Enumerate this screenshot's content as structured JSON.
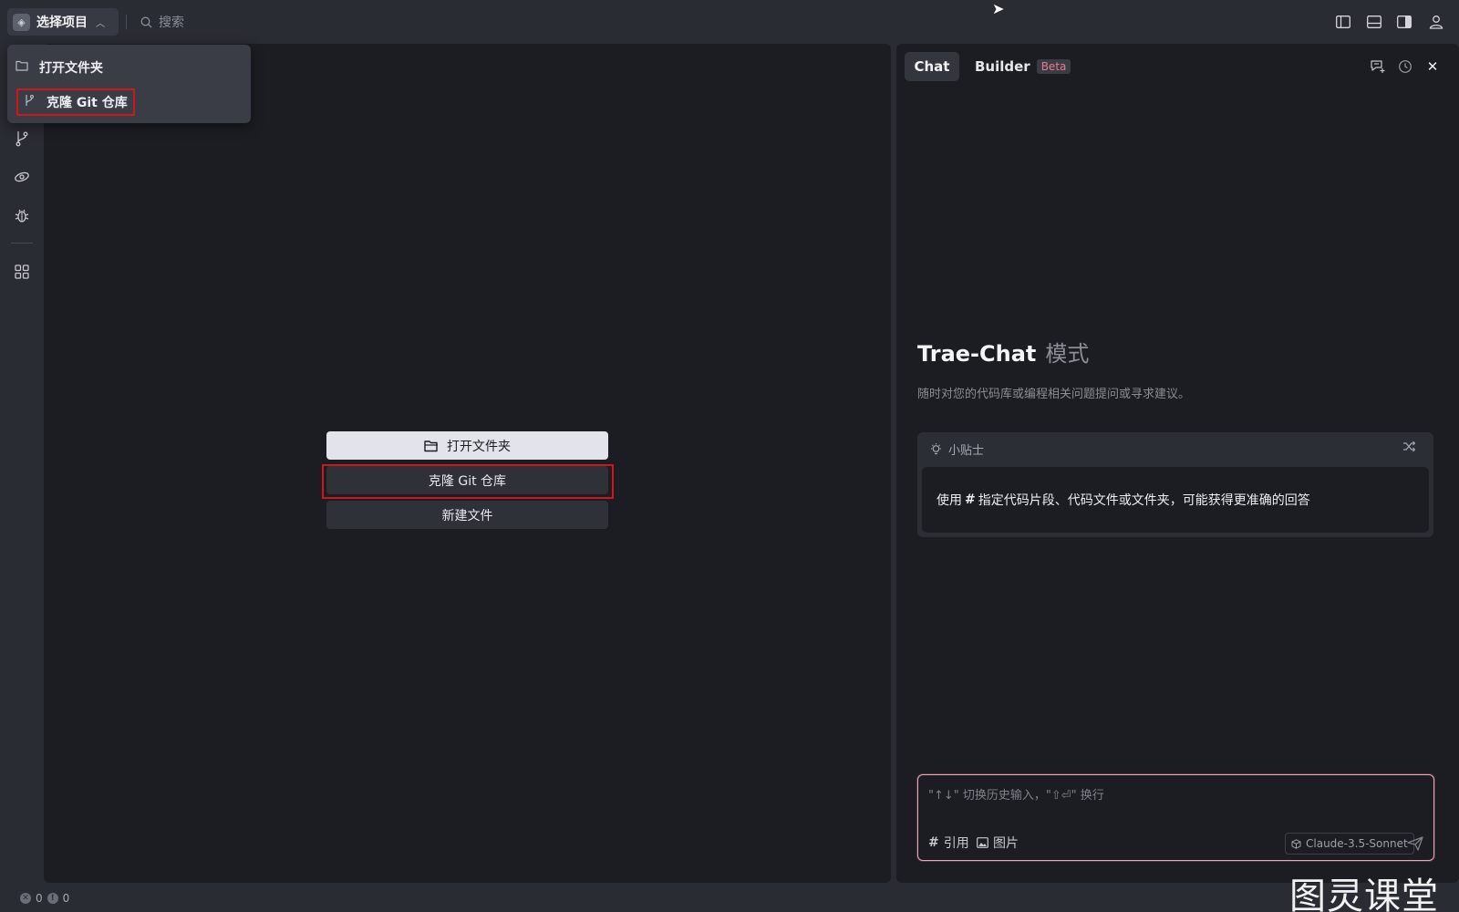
{
  "topbar": {
    "project_label": "选择项目",
    "search_placeholder": "搜索"
  },
  "dropdown": {
    "items": [
      {
        "label": "打开文件夹",
        "icon": "folder-icon"
      },
      {
        "label": "克隆 Git 仓库",
        "icon": "git-branch-icon"
      }
    ]
  },
  "editor": {
    "open_folder": "打开文件夹",
    "clone_repo": "克隆 Git 仓库",
    "new_file": "新建文件"
  },
  "chat": {
    "tabs": [
      {
        "label": "Chat",
        "active": true
      },
      {
        "label": "Builder",
        "badge": "Beta"
      }
    ],
    "title_main": "Trae-Chat",
    "title_mode": "模式",
    "description": "随时对您的代码库或编程相关问题提问或寻求建议。",
    "tips_header": "小贴士",
    "tip_prefix": "使用",
    "tip_symbol": "#",
    "tip_text": "指定代码片段、代码文件或文件夹，可能获得更准确的回答",
    "input_placeholder": "\"↑↓\" 切换历史输入，\"⇧⏎\" 换行",
    "ref_label": "引用",
    "image_label": "图片",
    "model": "Claude-3.5-Sonnet"
  },
  "statusbar": {
    "errors": "0",
    "warnings": "0"
  },
  "watermark": "图灵课堂",
  "colors": {
    "highlight_red": "#d1161b",
    "input_border": "#e8a8b8",
    "beta_text": "#e67b8f"
  }
}
